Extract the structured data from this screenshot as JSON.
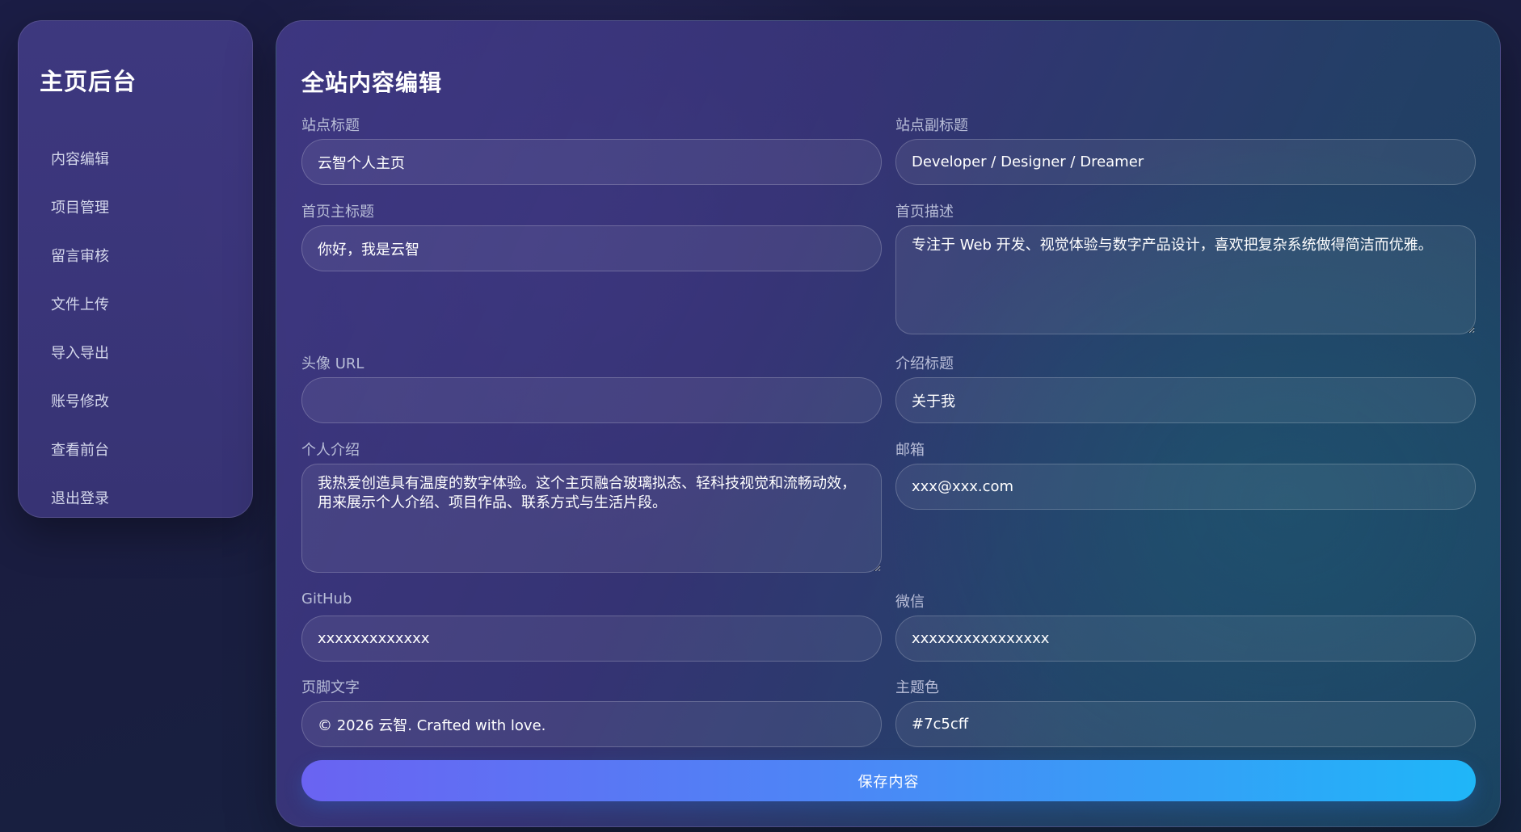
{
  "sidebar": {
    "title": "主页后台",
    "items": [
      {
        "label": "内容编辑"
      },
      {
        "label": "项目管理"
      },
      {
        "label": "留言审核"
      },
      {
        "label": "文件上传"
      },
      {
        "label": "导入导出"
      },
      {
        "label": "账号修改"
      },
      {
        "label": "查看前台"
      },
      {
        "label": "退出登录"
      }
    ]
  },
  "main": {
    "title": "全站内容编辑",
    "fields": {
      "site_title": {
        "label": "站点标题",
        "value": "云智个人主页"
      },
      "site_subtitle": {
        "label": "站点副标题",
        "value": "Developer / Designer / Dreamer"
      },
      "home_heading": {
        "label": "首页主标题",
        "value": "你好，我是云智"
      },
      "home_description": {
        "label": "首页描述",
        "value": "专注于 Web 开发、视觉体验与数字产品设计，喜欢把复杂系统做得简洁而优雅。"
      },
      "avatar_url": {
        "label": "头像 URL",
        "value": ""
      },
      "intro_title": {
        "label": "介绍标题",
        "value": "关于我"
      },
      "bio": {
        "label": "个人介绍",
        "value": "我热爱创造具有温度的数字体验。这个主页融合玻璃拟态、轻科技视觉和流畅动效，用来展示个人介绍、项目作品、联系方式与生活片段。"
      },
      "email": {
        "label": "邮箱",
        "value": "xxx@xxx.com"
      },
      "github": {
        "label": "GitHub",
        "value": "xxxxxxxxxxxxx"
      },
      "wechat": {
        "label": "微信",
        "value": "xxxxxxxxxxxxxxxx"
      },
      "footer_text": {
        "label": "页脚文字",
        "value": "© 2026 云智. Crafted with love."
      },
      "theme_color": {
        "label": "主题色",
        "value": "#7c5cff"
      }
    },
    "save_label": "保存内容"
  },
  "colors": {
    "theme": "#7c5cff",
    "button_gradient_start": "#6a63f2",
    "button_gradient_end": "#1fb6f8"
  }
}
